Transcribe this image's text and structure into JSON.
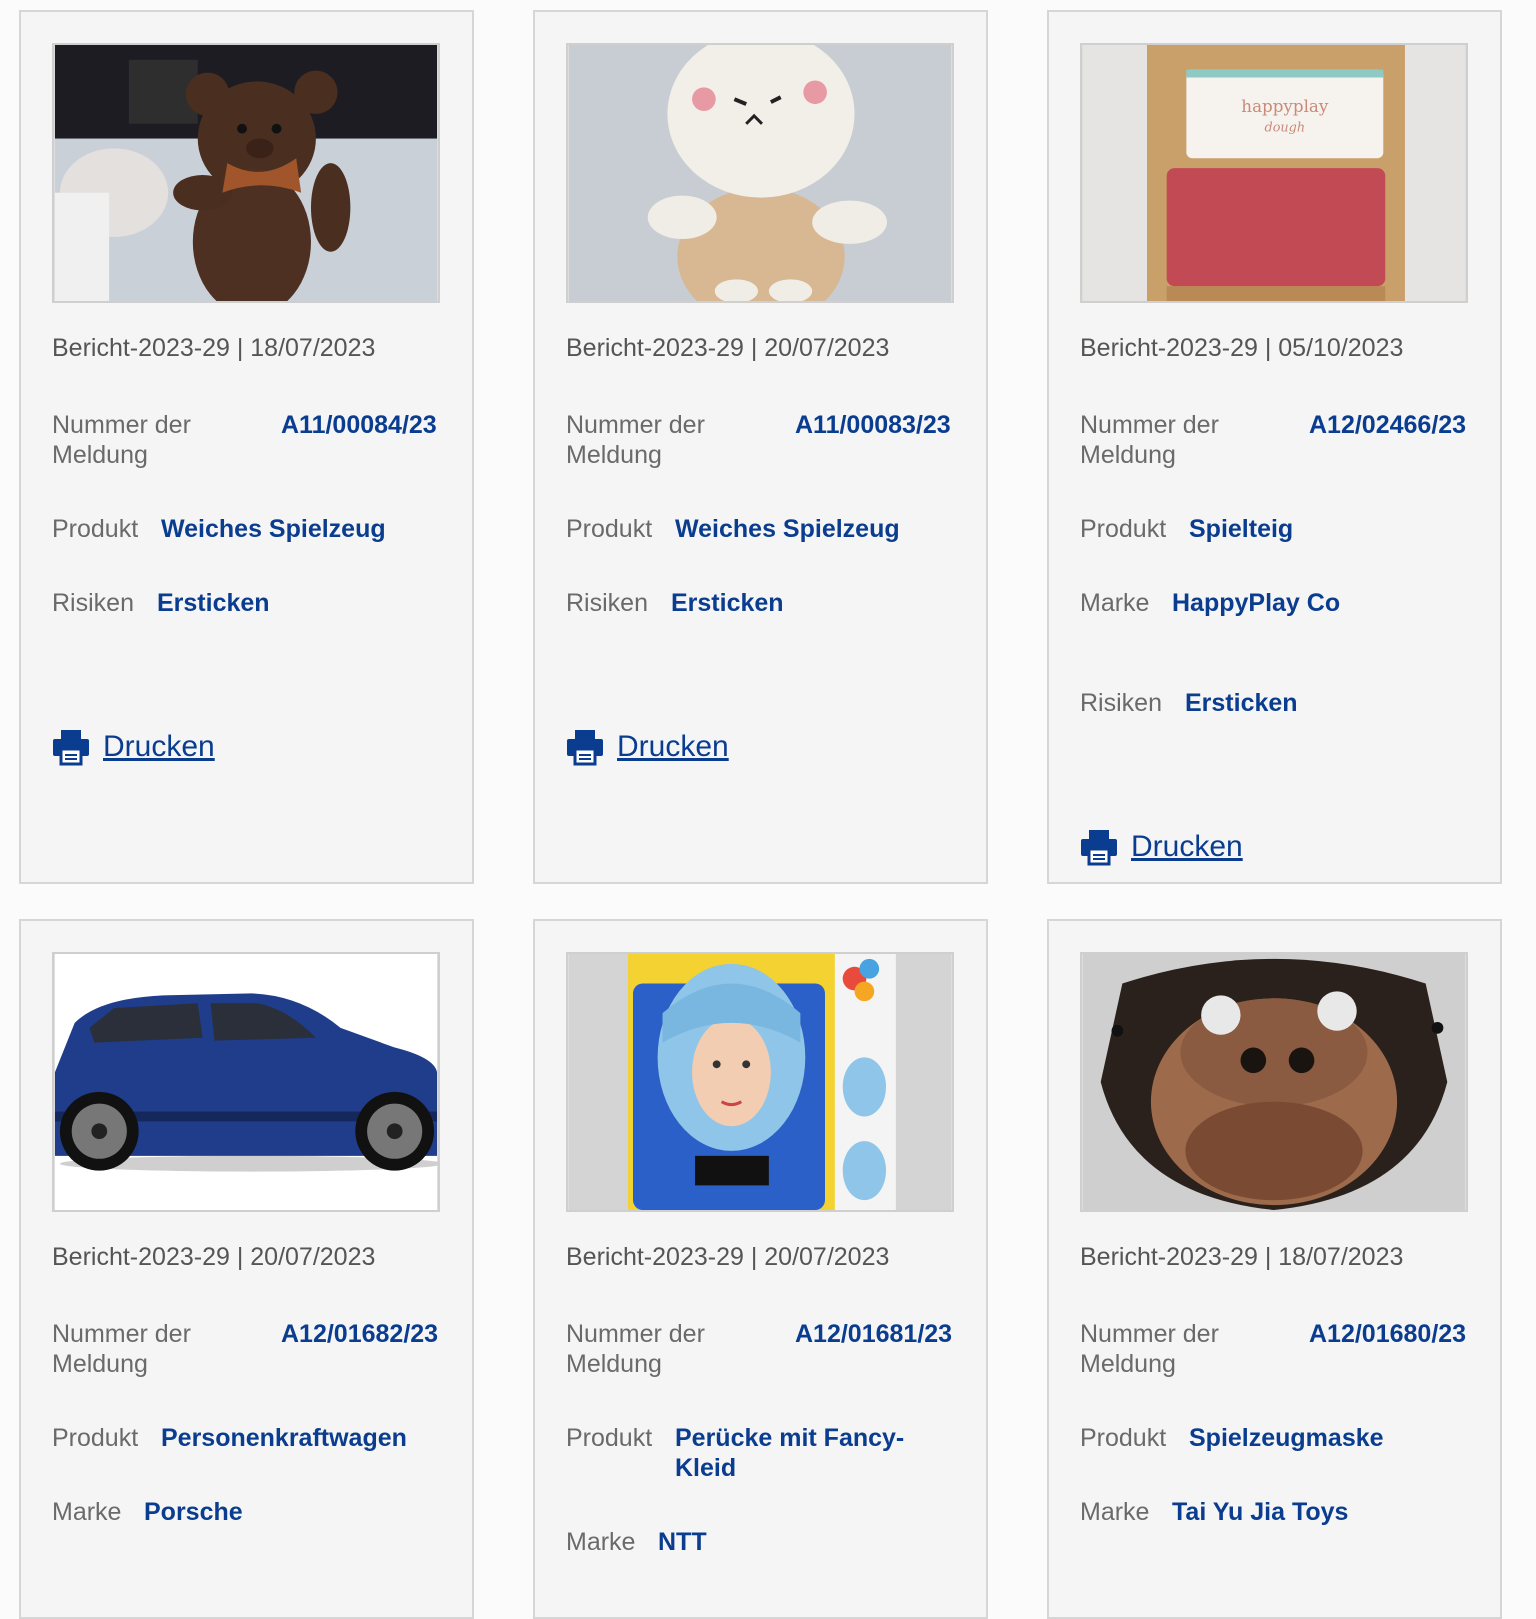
{
  "labels": {
    "notification_number": "Nummer der Meldung",
    "product": "Produkt",
    "risks": "Risiken",
    "brand": "Marke",
    "print": "Drucken"
  },
  "cards": [
    {
      "report": "Bericht-2023-29 | 18/07/2023",
      "number": "A11/00084/23",
      "product": "Weiches Spielzeug",
      "risks": "Ersticken",
      "image_icon": "brown-teddy-bear"
    },
    {
      "report": "Bericht-2023-29 | 20/07/2023",
      "number": "A11/00083/23",
      "product": "Weiches Spielzeug",
      "risks": "Ersticken",
      "image_icon": "white-plush-toy"
    },
    {
      "report": "Bericht-2023-29 | 05/10/2023",
      "number": "A12/02466/23",
      "product": "Spielteig",
      "brand": "HappyPlay Co",
      "risks": "Ersticken",
      "image_icon": "play-dough-bag",
      "image_text": [
        "happyplay",
        "dough"
      ]
    },
    {
      "report": "Bericht-2023-29 | 20/07/2023",
      "number": "A12/01682/23",
      "product": "Personenkraftwagen",
      "brand": "Porsche",
      "image_icon": "blue-suv-car"
    },
    {
      "report": "Bericht-2023-29 | 20/07/2023",
      "number": "A12/01681/23",
      "product_lines": [
        "Perücke mit Fancy-",
        "Kleid"
      ],
      "brand": "NTT",
      "image_icon": "blue-wig-package"
    },
    {
      "report": "Bericht-2023-29 | 18/07/2023",
      "number": "A12/01680/23",
      "product": "Spielzeugmaske",
      "brand": "Tai Yu Jia Toys",
      "image_icon": "monkey-mask"
    }
  ]
}
